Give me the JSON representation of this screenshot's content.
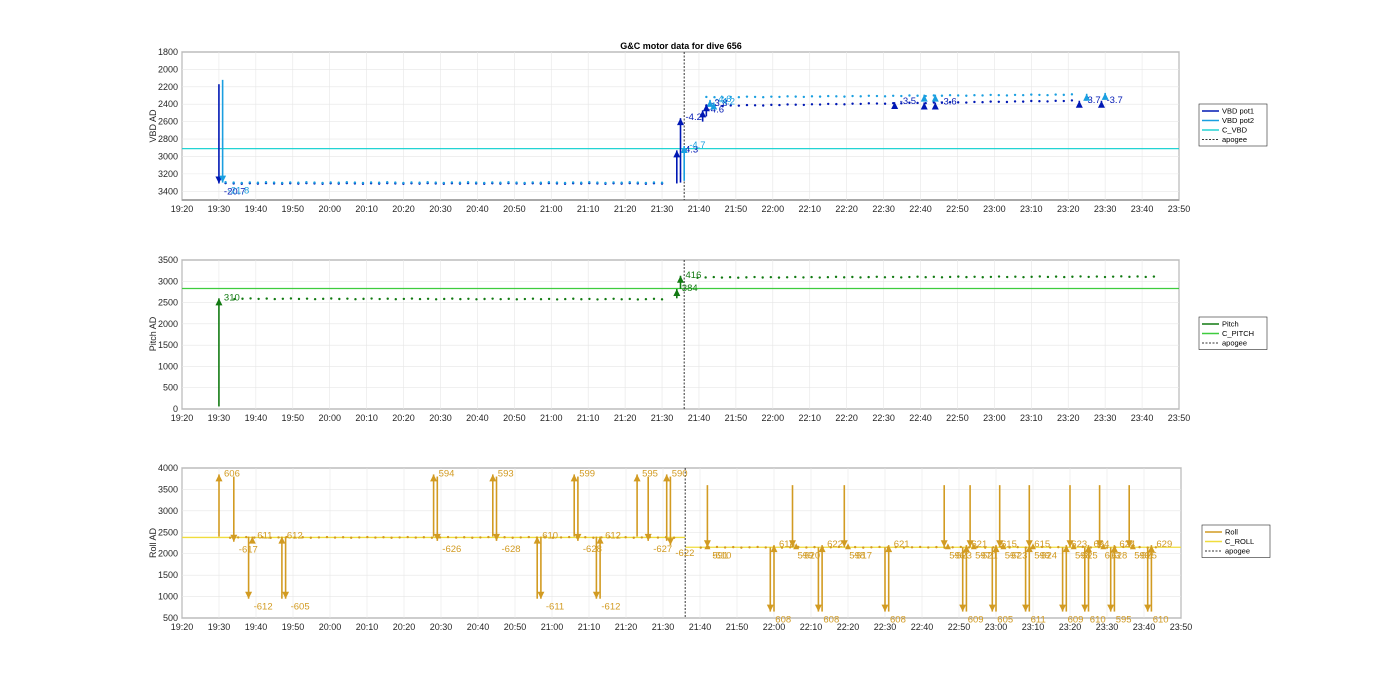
{
  "title": "G&C motor data for dive 656",
  "x_ticks": [
    "19:20",
    "19:30",
    "19:40",
    "19:50",
    "20:00",
    "20:10",
    "20:20",
    "20:30",
    "20:40",
    "20:50",
    "21:00",
    "21:10",
    "21:20",
    "21:30",
    "21:40",
    "21:50",
    "22:00",
    "22:10",
    "22:20",
    "22:30",
    "22:40",
    "22:50",
    "23:00",
    "23:10",
    "23:20",
    "23:30",
    "23:40",
    "23:50"
  ],
  "apogee_time": "21:36",
  "chart_data": [
    {
      "type": "scatter",
      "ylabel": "VBD AD",
      "ylim": [
        3500,
        1800
      ],
      "y_reversed": true,
      "yticks": [
        1800,
        2000,
        2200,
        2400,
        2600,
        2800,
        3000,
        3200,
        3400
      ],
      "grid": true,
      "legend_position": "right",
      "legend": [
        "VBD pot1",
        "VBD pot2",
        "C_VBD",
        "apogee"
      ],
      "colors": {
        "pot1": "#0018b4",
        "pot2": "#1a9fe0",
        "c": "#22d4d4"
      },
      "c_value": 2910,
      "series": [
        {
          "name": "VBD pot1",
          "values": [
            [
              19.53,
              3310
            ],
            [
              21.5,
              3310
            ],
            [
              21.7,
              2420
            ],
            [
              23.35,
              2360
            ]
          ]
        },
        {
          "name": "VBD pot2",
          "values": [
            [
              19.53,
              3300
            ],
            [
              21.5,
              3300
            ],
            [
              21.7,
              2320
            ],
            [
              23.35,
              2290
            ]
          ]
        }
      ],
      "arrows": [
        {
          "series": "pot1",
          "t": "19:30",
          "from": 2170,
          "to": 3310,
          "label": "-20.7"
        },
        {
          "series": "pot2",
          "t": "19:31",
          "from": 2120,
          "to": 3300,
          "label": "-21.8"
        },
        {
          "series": "pot1",
          "t": "21:34",
          "from": 3310,
          "to": 2930,
          "label": "-4.3"
        },
        {
          "series": "pot1",
          "t": "21:35",
          "from": 3300,
          "to": 2560,
          "label": "-4.2"
        },
        {
          "series": "pot2",
          "t": "21:36",
          "from": 3280,
          "to": 2880,
          "label": "-4.7"
        },
        {
          "series": "pot1",
          "t": "21:41",
          "from": 2600,
          "to": 2470,
          "label": "-4.6"
        },
        {
          "series": "pot2",
          "t": "21:43",
          "from": 2420,
          "to": 2350,
          "label": "-4.6"
        },
        {
          "series": "pot1",
          "t": "21:42",
          "from": 2540,
          "to": 2400,
          "label": "-3.8"
        },
        {
          "series": "pot2",
          "t": "21:44",
          "from": 2430,
          "to": 2380,
          "label": "-4.2"
        },
        {
          "series": "pot1",
          "t": "22:33",
          "from": 2380,
          "to": 2375,
          "label": "-3.5"
        },
        {
          "series": "pot1",
          "t": "22:41",
          "from": 2400,
          "to": 2380,
          "label": ""
        },
        {
          "series": "pot2",
          "t": "22:41",
          "from": 2320,
          "to": 2290,
          "label": ""
        },
        {
          "series": "pot1",
          "t": "22:44",
          "from": 2400,
          "to": 2380,
          "label": "-3.6"
        },
        {
          "series": "pot2",
          "t": "22:44",
          "from": 2320,
          "to": 2290,
          "label": ""
        },
        {
          "series": "pot1",
          "t": "23:23",
          "from": 2380,
          "to": 2360,
          "label": "-3.7"
        },
        {
          "series": "pot2",
          "t": "23:25",
          "from": 2310,
          "to": 2280,
          "label": ""
        },
        {
          "series": "pot1",
          "t": "23:29",
          "from": 2380,
          "to": 2360,
          "label": "-3.7"
        },
        {
          "series": "pot2",
          "t": "23:30",
          "from": 2300,
          "to": 2270,
          "label": ""
        }
      ]
    },
    {
      "type": "scatter",
      "ylabel": "Pitch AD",
      "ylim": [
        0,
        3500
      ],
      "yticks": [
        0,
        500,
        1000,
        1500,
        2000,
        2500,
        3000,
        3500
      ],
      "grid": true,
      "legend_position": "right",
      "legend": [
        "Pitch",
        "C_PITCH",
        "apogee"
      ],
      "colors": {
        "pitch": "#127a12",
        "c": "#3ecc3e"
      },
      "c_value": 2830,
      "series": [
        {
          "name": "Pitch",
          "values": [
            [
              19.57,
              2590
            ],
            [
              21.5,
              2580
            ],
            [
              21.66,
              3090
            ],
            [
              23.72,
              3110
            ]
          ]
        }
      ],
      "arrows": [
        {
          "t": "19:30",
          "from": 60,
          "to": 2600,
          "label": "310"
        },
        {
          "t": "21:34",
          "from": 2600,
          "to": 2820,
          "label": "384"
        },
        {
          "t": "21:35",
          "from": 2820,
          "to": 3130,
          "label": "416"
        }
      ]
    },
    {
      "type": "scatter",
      "ylabel": "Roll AD",
      "ylim": [
        500,
        4000
      ],
      "yticks": [
        500,
        1000,
        1500,
        2000,
        2500,
        3000,
        3500,
        4000
      ],
      "grid": true,
      "legend_position": "right",
      "legend": [
        "Roll",
        "C_ROLL",
        "apogee"
      ],
      "colors": {
        "roll": "#d29b22",
        "c": "#f0dd3c"
      },
      "c_values": [
        {
          "until": "21:36",
          "value": 2380
        },
        {
          "from": "21:36",
          "value": 2150
        }
      ],
      "series": [
        {
          "name": "Roll",
          "values": [
            [
              19.55,
              2380
            ],
            [
              21.55,
              2380
            ],
            [
              21.67,
              2150
            ],
            [
              23.72,
              2150
            ]
          ]
        }
      ],
      "arrows": [
        {
          "t": "19:30",
          "from": 2400,
          "to": 3850,
          "label": "606"
        },
        {
          "t": "19:34",
          "from": 3800,
          "to": 2280,
          "label": "-617"
        },
        {
          "t": "19:39",
          "from": 2350,
          "to": 2400,
          "label": "611"
        },
        {
          "t": "19:38",
          "from": 2400,
          "to": 950,
          "label": "-612"
        },
        {
          "t": "19:47",
          "from": 950,
          "to": 2400,
          "label": "612"
        },
        {
          "t": "19:48",
          "from": 2400,
          "to": 950,
          "label": "-605"
        },
        {
          "t": "20:28",
          "from": 2400,
          "to": 3850,
          "label": "594"
        },
        {
          "t": "20:29",
          "from": 3800,
          "to": 2300,
          "label": "-626"
        },
        {
          "t": "20:44",
          "from": 2400,
          "to": 3850,
          "label": "593"
        },
        {
          "t": "20:45",
          "from": 3800,
          "to": 2300,
          "label": "-628"
        },
        {
          "t": "20:56",
          "from": 950,
          "to": 2400,
          "label": "610"
        },
        {
          "t": "20:57",
          "from": 2400,
          "to": 950,
          "label": "-611"
        },
        {
          "t": "21:06",
          "from": 2400,
          "to": 3850,
          "label": "599"
        },
        {
          "t": "21:07",
          "from": 3800,
          "to": 2300,
          "label": "-628"
        },
        {
          "t": "21:13",
          "from": 950,
          "to": 2400,
          "label": "612"
        },
        {
          "t": "21:12",
          "from": 2400,
          "to": 950,
          "label": "-612"
        },
        {
          "t": "21:23",
          "from": 2400,
          "to": 3850,
          "label": "595"
        },
        {
          "t": "21:26",
          "from": 3800,
          "to": 2300,
          "label": "-627"
        },
        {
          "t": "21:31",
          "from": 2300,
          "to": 3850,
          "label": "590"
        },
        {
          "t": "21:32",
          "from": 3800,
          "to": 2200,
          "label": "-622"
        },
        {
          "t": "21:42",
          "from": 3600,
          "to": 2150,
          "label": "591"
        },
        {
          "t": "21:42",
          "from": 2150,
          "to": 2150,
          "label": "-610"
        },
        {
          "t": "21:59",
          "from": 2150,
          "to": 650,
          "label": "608"
        },
        {
          "t": "22:00",
          "from": 650,
          "to": 2200,
          "label": "618"
        },
        {
          "t": "22:05",
          "from": 3600,
          "to": 2150,
          "label": "599"
        },
        {
          "t": "22:06",
          "from": 2150,
          "to": 2150,
          "label": "-620"
        },
        {
          "t": "22:12",
          "from": 2150,
          "to": 650,
          "label": "608"
        },
        {
          "t": "22:13",
          "from": 650,
          "to": 2200,
          "label": "622"
        },
        {
          "t": "22:19",
          "from": 3600,
          "to": 2150,
          "label": "598"
        },
        {
          "t": "22:20",
          "from": 2150,
          "to": 2150,
          "label": "-617"
        },
        {
          "t": "22:30",
          "from": 2150,
          "to": 650,
          "label": "608"
        },
        {
          "t": "22:31",
          "from": 650,
          "to": 2200,
          "label": "621"
        },
        {
          "t": "22:46",
          "from": 3600,
          "to": 2150,
          "label": "596"
        },
        {
          "t": "22:47",
          "from": 2150,
          "to": 2150,
          "label": "-623"
        },
        {
          "t": "22:51",
          "from": 2150,
          "to": 650,
          "label": "609"
        },
        {
          "t": "22:52",
          "from": 650,
          "to": 2200,
          "label": "621"
        },
        {
          "t": "22:53",
          "from": 3600,
          "to": 2150,
          "label": "597"
        },
        {
          "t": "22:54",
          "from": 2150,
          "to": 2150,
          "label": "-621"
        },
        {
          "t": "22:59",
          "from": 2150,
          "to": 650,
          "label": "605"
        },
        {
          "t": "23:00",
          "from": 650,
          "to": 2200,
          "label": "615"
        },
        {
          "t": "23:01",
          "from": 3600,
          "to": 2150,
          "label": "597"
        },
        {
          "t": "23:02",
          "from": 2150,
          "to": 2150,
          "label": "-623"
        },
        {
          "t": "23:08",
          "from": 2150,
          "to": 650,
          "label": "611"
        },
        {
          "t": "23:09",
          "from": 650,
          "to": 2200,
          "label": "615"
        },
        {
          "t": "23:09",
          "from": 3600,
          "to": 2150,
          "label": "599"
        },
        {
          "t": "23:10",
          "from": 2150,
          "to": 2150,
          "label": "-624"
        },
        {
          "t": "23:18",
          "from": 2150,
          "to": 650,
          "label": "609"
        },
        {
          "t": "23:19",
          "from": 650,
          "to": 2200,
          "label": "623"
        },
        {
          "t": "23:20",
          "from": 3600,
          "to": 2150,
          "label": "598"
        },
        {
          "t": "23:21",
          "from": 2150,
          "to": 2150,
          "label": "-625"
        },
        {
          "t": "23:24",
          "from": 2150,
          "to": 650,
          "label": "610"
        },
        {
          "t": "23:25",
          "from": 650,
          "to": 2200,
          "label": "624"
        },
        {
          "t": "23:28",
          "from": 3600,
          "to": 2150,
          "label": "603"
        },
        {
          "t": "23:29",
          "from": 2150,
          "to": 2150,
          "label": "-628"
        },
        {
          "t": "23:31",
          "from": 2150,
          "to": 650,
          "label": "595"
        },
        {
          "t": "23:32",
          "from": 650,
          "to": 2200,
          "label": "624"
        },
        {
          "t": "23:36",
          "from": 3600,
          "to": 2150,
          "label": "599"
        },
        {
          "t": "23:37",
          "from": 2150,
          "to": 2150,
          "label": "-625"
        },
        {
          "t": "23:41",
          "from": 2150,
          "to": 650,
          "label": "610"
        },
        {
          "t": "23:42",
          "from": 650,
          "to": 2200,
          "label": "629"
        }
      ]
    }
  ]
}
